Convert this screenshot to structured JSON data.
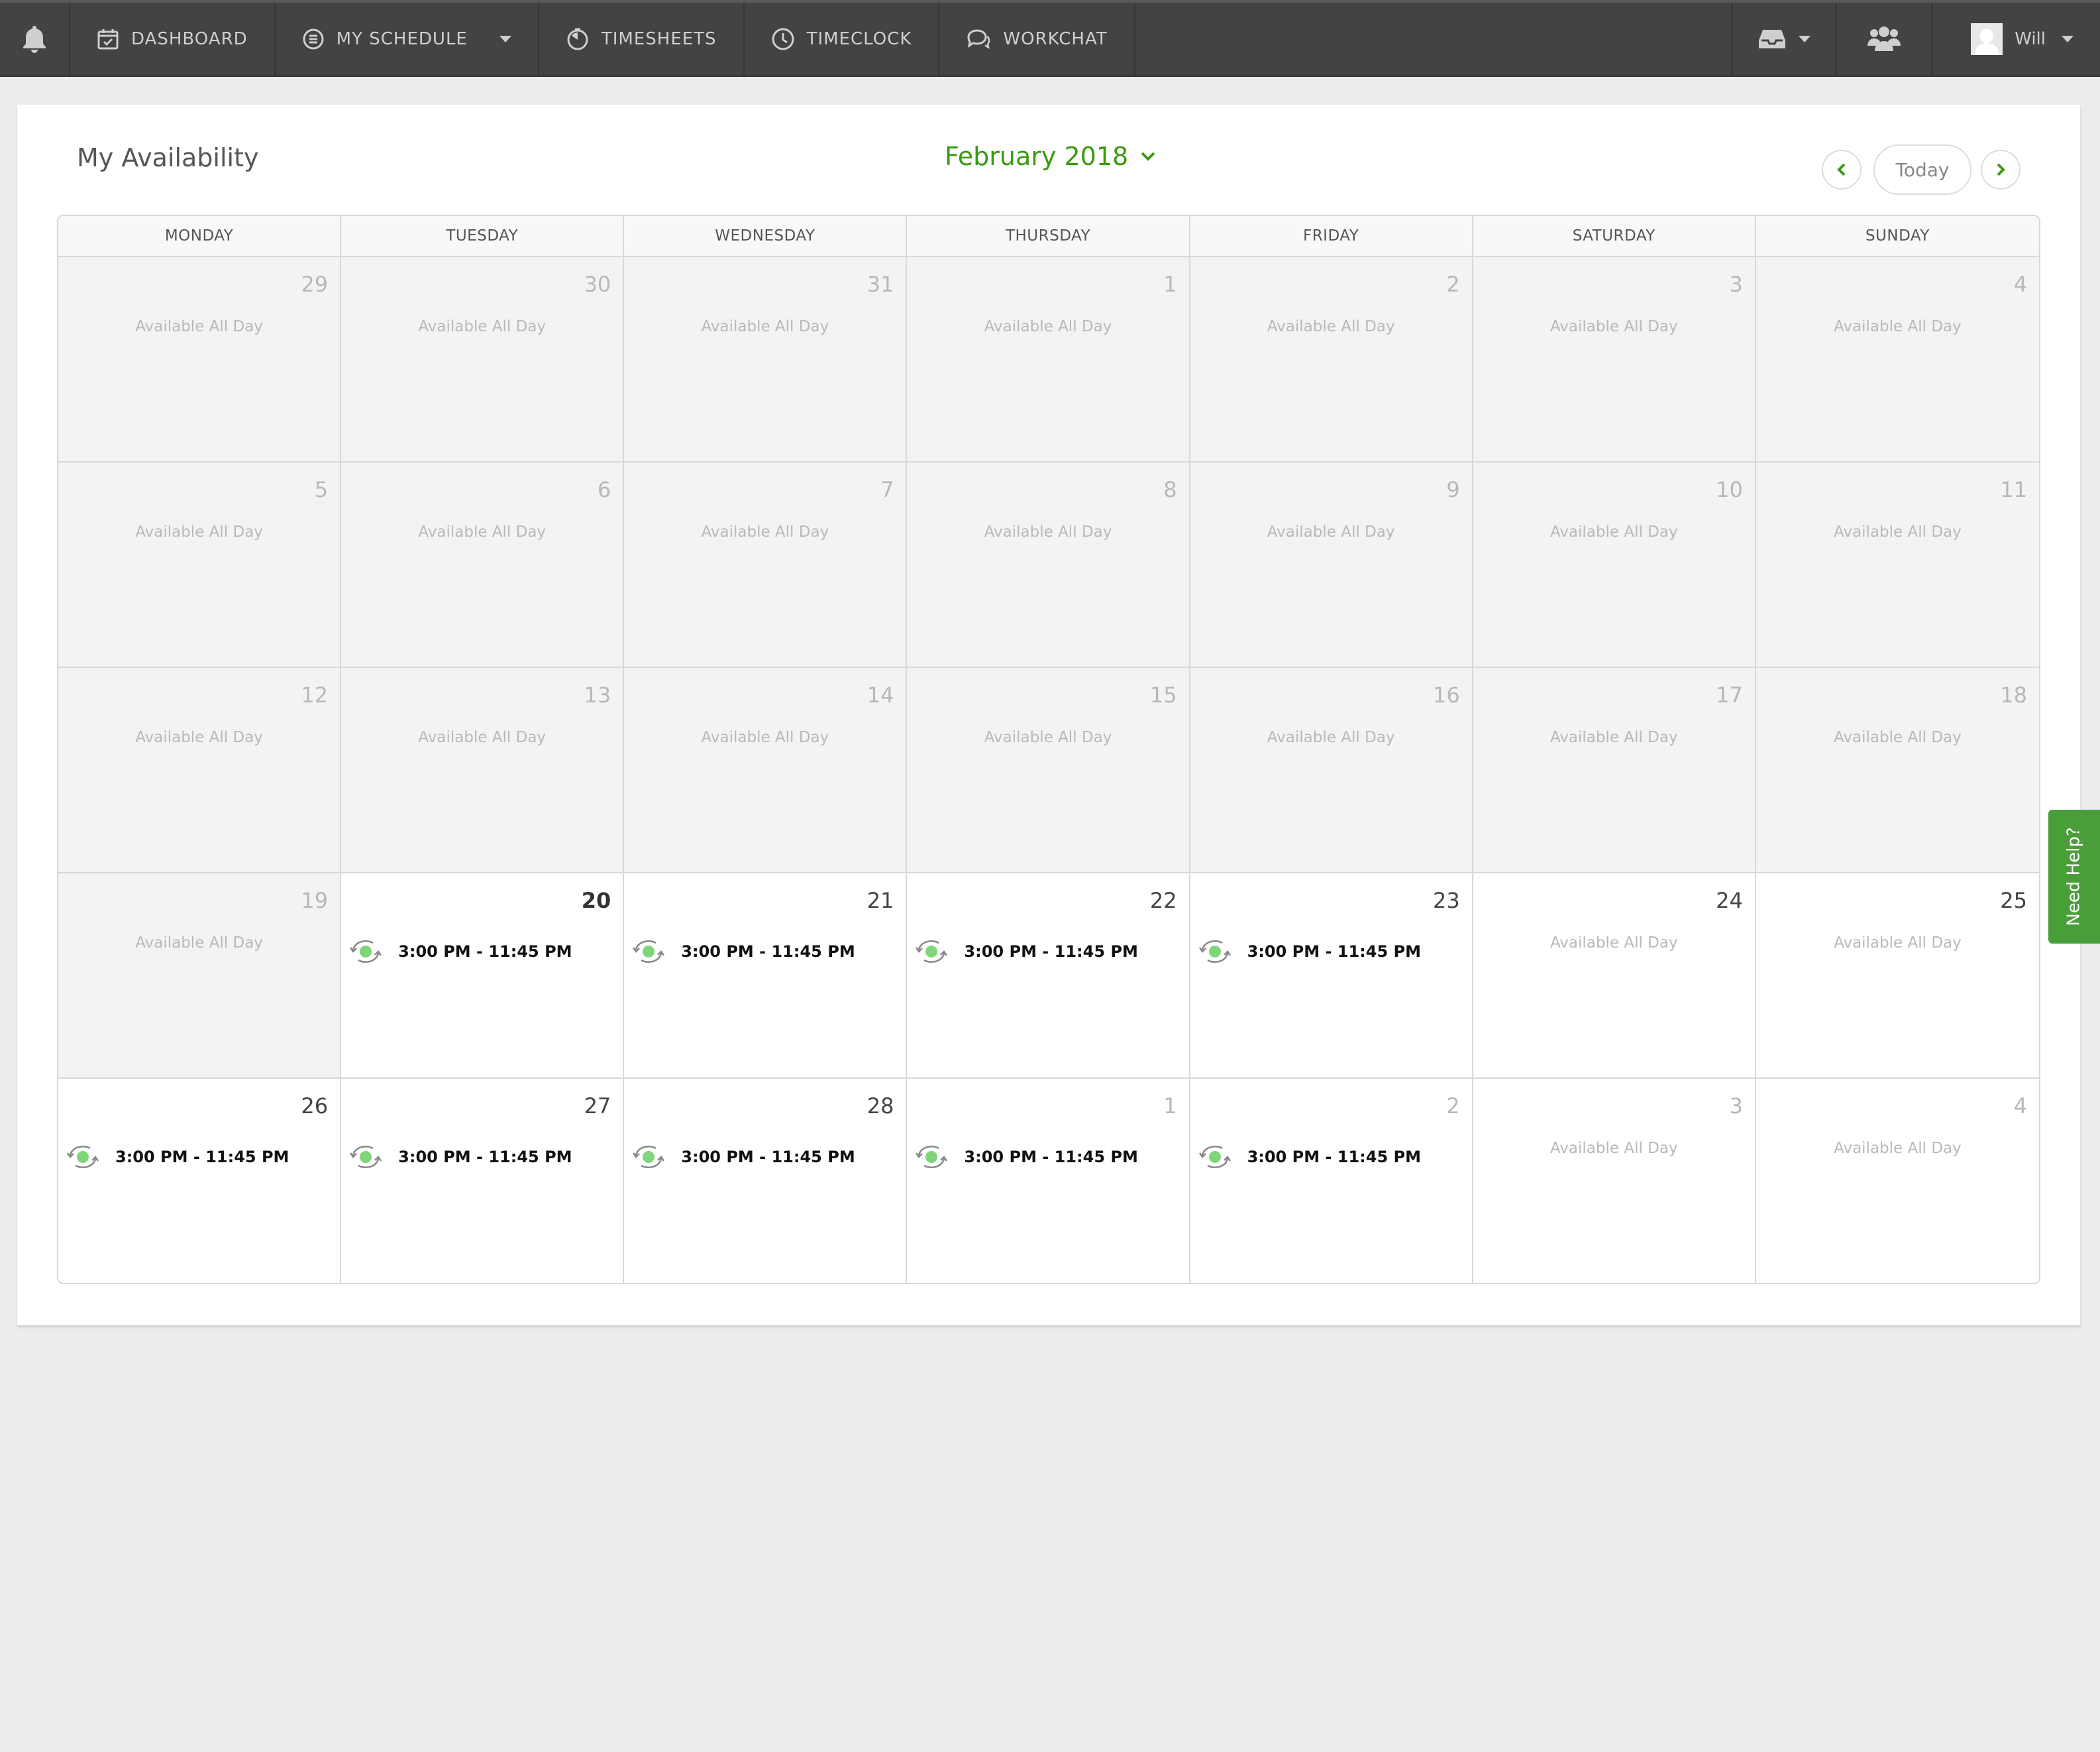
{
  "nav": {
    "items": [
      {
        "label": "DASHBOARD",
        "icon": "calendar-check-icon"
      },
      {
        "label": "MY SCHEDULE",
        "icon": "list-circle-icon"
      },
      {
        "label": "TIMESHEETS",
        "icon": "stopwatch-icon"
      },
      {
        "label": "TIMECLOCK",
        "icon": "clock-icon"
      },
      {
        "label": "WORKCHAT",
        "icon": "chat-bubbles-icon"
      }
    ],
    "user_name": "Will"
  },
  "page": {
    "title": "My Availability",
    "month_label": "February 2018",
    "today_label": "Today"
  },
  "calendar": {
    "weekdays": [
      "MONDAY",
      "TUESDAY",
      "WEDNESDAY",
      "THURSDAY",
      "FRIDAY",
      "SATURDAY",
      "SUNDAY"
    ],
    "weeks": [
      [
        {
          "day": "29",
          "status": "past",
          "text": "Available All Day"
        },
        {
          "day": "30",
          "status": "past",
          "text": "Available All Day"
        },
        {
          "day": "31",
          "status": "past",
          "text": "Available All Day"
        },
        {
          "day": "1",
          "status": "past",
          "text": "Available All Day"
        },
        {
          "day": "2",
          "status": "past",
          "text": "Available All Day"
        },
        {
          "day": "3",
          "status": "past",
          "text": "Available All Day"
        },
        {
          "day": "4",
          "status": "past",
          "text": "Available All Day"
        }
      ],
      [
        {
          "day": "5",
          "status": "past",
          "text": "Available All Day"
        },
        {
          "day": "6",
          "status": "past",
          "text": "Available All Day"
        },
        {
          "day": "7",
          "status": "past",
          "text": "Available All Day"
        },
        {
          "day": "8",
          "status": "past",
          "text": "Available All Day"
        },
        {
          "day": "9",
          "status": "past",
          "text": "Available All Day"
        },
        {
          "day": "10",
          "status": "past",
          "text": "Available All Day"
        },
        {
          "day": "11",
          "status": "past",
          "text": "Available All Day"
        }
      ],
      [
        {
          "day": "12",
          "status": "past",
          "text": "Available All Day"
        },
        {
          "day": "13",
          "status": "past",
          "text": "Available All Day"
        },
        {
          "day": "14",
          "status": "past",
          "text": "Available All Day"
        },
        {
          "day": "15",
          "status": "past",
          "text": "Available All Day"
        },
        {
          "day": "16",
          "status": "past",
          "text": "Available All Day"
        },
        {
          "day": "17",
          "status": "past",
          "text": "Available All Day"
        },
        {
          "day": "18",
          "status": "past",
          "text": "Available All Day"
        }
      ],
      [
        {
          "day": "19",
          "status": "past",
          "text": "Available All Day"
        },
        {
          "day": "20",
          "status": "today",
          "shift": "3:00 PM - 11:45 PM"
        },
        {
          "day": "21",
          "status": "current",
          "shift": "3:00 PM - 11:45 PM"
        },
        {
          "day": "22",
          "status": "current",
          "shift": "3:00 PM - 11:45 PM"
        },
        {
          "day": "23",
          "status": "current",
          "shift": "3:00 PM - 11:45 PM"
        },
        {
          "day": "24",
          "status": "current",
          "text": "Available All Day"
        },
        {
          "day": "25",
          "status": "current",
          "text": "Available All Day"
        }
      ],
      [
        {
          "day": "26",
          "status": "current",
          "shift": "3:00 PM - 11:45 PM"
        },
        {
          "day": "27",
          "status": "current",
          "shift": "3:00 PM - 11:45 PM"
        },
        {
          "day": "28",
          "status": "current",
          "shift": "3:00 PM - 11:45 PM"
        },
        {
          "day": "1",
          "status": "future",
          "shift": "3:00 PM - 11:45 PM"
        },
        {
          "day": "2",
          "status": "future",
          "shift": "3:00 PM - 11:45 PM"
        },
        {
          "day": "3",
          "status": "future",
          "text": "Available All Day"
        },
        {
          "day": "4",
          "status": "future",
          "text": "Available All Day"
        }
      ]
    ]
  },
  "help_tab": {
    "label": "Need Help?"
  },
  "colors": {
    "accent_green": "#3a9a12",
    "nav_bg": "#434343",
    "help_green": "#4a9e3a",
    "shift_dot": "#7fd67a"
  }
}
